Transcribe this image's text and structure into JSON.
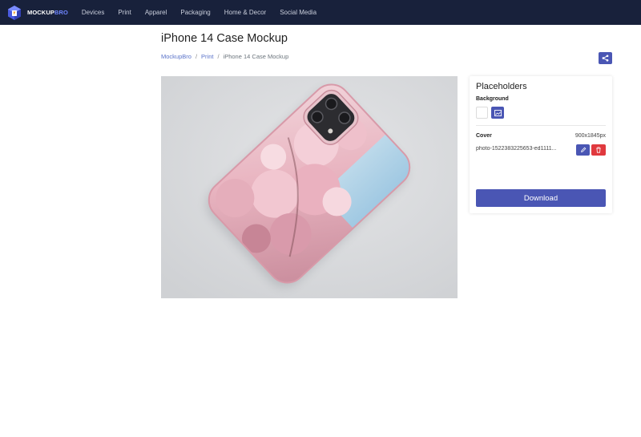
{
  "colors": {
    "navbar_bg": "#18213b",
    "accent": "#4a56b4",
    "danger": "#e0393e",
    "brand_accent": "#6f86ff",
    "link": "#5a73c9"
  },
  "navbar": {
    "brand_main": "MOCKUP",
    "brand_accent": "BRO",
    "logo_icon": "cube-logo-icon",
    "links": [
      "Devices",
      "Print",
      "Apparel",
      "Packaging",
      "Home & Decor",
      "Social Media"
    ]
  },
  "page": {
    "title": "iPhone 14 Case Mockup",
    "breadcrumb": {
      "items": [
        "MockupBro",
        "Print"
      ],
      "separator": "/",
      "current": "iPhone 14 Case Mockup"
    },
    "share_icon": "share-icon"
  },
  "preview": {
    "image_icon": "phone-case-mockup-image"
  },
  "placeholders": {
    "title": "Placeholders",
    "background_label": "Background",
    "background_options": [
      "white-color-swatch",
      "image-icon"
    ],
    "cover_label": "Cover",
    "cover_size": "900x1845px",
    "file_name": "photo-1522383225653-ed1111...",
    "edit_icon": "pencil-icon",
    "delete_icon": "trash-icon",
    "download_label": "Download"
  }
}
